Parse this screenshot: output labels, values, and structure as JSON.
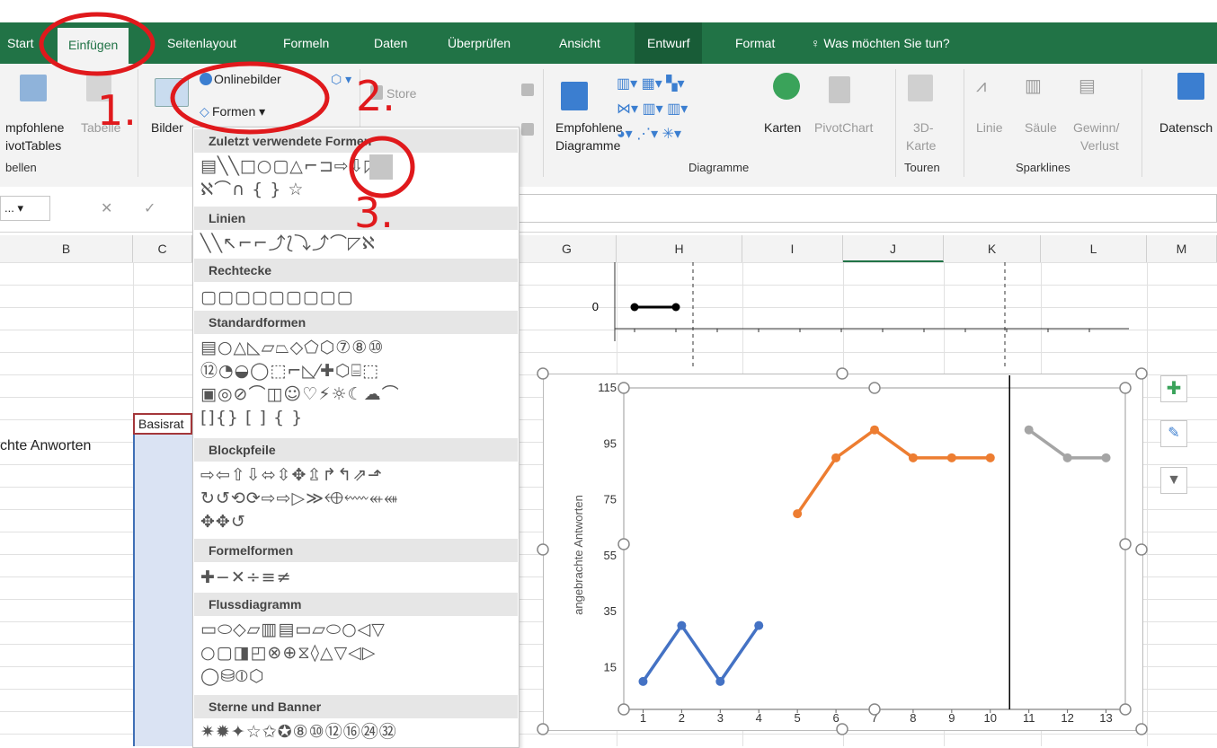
{
  "tabs": {
    "start": "Start",
    "einfuegen": "Einfügen",
    "seitenlayout": "Seitenlayout",
    "formeln": "Formeln",
    "daten": "Daten",
    "ueberpruefen": "Überprüfen",
    "ansicht": "Ansicht",
    "entwurf": "Entwurf",
    "format": "Format",
    "tellme": "Was möchten Sie tun?"
  },
  "ribbon": {
    "pivot_line1": "mpfohlene",
    "pivot_line2": "ivotTables",
    "tabelle": "Tabelle",
    "group_tabellen": "bellen",
    "bilder": "Bilder",
    "onlinebilder": "Onlinebilder",
    "formen": "Formen",
    "store": "Store",
    "empf_diag_line1": "Empfohlene",
    "empf_diag_line2": "Diagramme",
    "karten": "Karten",
    "pivotchart": "PivotChart",
    "karte3d_line1": "3D-",
    "karte3d_line2": "Karte",
    "linie": "Linie",
    "saeule": "Säule",
    "gewinn_line1": "Gewinn/",
    "gewinn_line2": "Verlust",
    "datensch": "Datensch",
    "group_diagramme": "Diagramme",
    "group_touren": "Touren",
    "group_sparklines": "Sparklines"
  },
  "namebox": "...",
  "columns": [
    "B",
    "C",
    "G",
    "H",
    "I",
    "J",
    "K",
    "L",
    "M"
  ],
  "cells": {
    "basisrat": "Basisrat",
    "anworten": "chte Anworten"
  },
  "menu": {
    "sec_zuletzt": "Zuletzt verwendete Formen",
    "zuletzt_row1": "▤╲╲□○▢△⌐⊐⇨⇩◸",
    "zuletzt_row2": "ℵ⌒∩ { } ☆",
    "sec_linien": "Linien",
    "linien_row": "╲╲↖⌐⌐⤴⟅⤵⤴⌒◸ℵ",
    "sec_rechtecke": "Rechtecke",
    "rechtecke_row": "▢▢▢▢▢▢▢▢▢",
    "sec_standard": "Standardformen",
    "standard_row1": "▤○△◺▱⏢◇⬠⬡⑦⑧⑩",
    "standard_row2": "⑫◔◒◯⬚⌐◺⁄✚⬡⌸⬚",
    "standard_row3": "▣◎⊘⌒◫☺♡⚡☼☾☁⌒",
    "standard_row4": "[]{} [ ] { }",
    "sec_blockpfeile": "Blockpfeile",
    "block_row1": "⇨⇦⇧⇩⬄⇳✥⇫↱↰⇗⬏",
    "block_row2": "↻↺⟲⟳⇨⇨▷≫⬲⬳⬴⬵",
    "block_row3": "✥✥↺",
    "sec_formel": "Formelformen",
    "formel_row": "✚−✕÷≡≠",
    "sec_fluss": "Flussdiagramm",
    "fluss_row1": "▭⬭◇▱▥▤▭▱⬭○◁▽",
    "fluss_row2": "○▢◨◰⊗⊕⧖◊△▽◁▷",
    "fluss_row3": "◯⛁⦶⬡",
    "sec_sterne": "Sterne und Banner",
    "sterne_row": "✷✹✦☆✩✪⑧⑩⑫⑯㉔㉜"
  },
  "annotations": {
    "a1": "1.",
    "a2": "2.",
    "a3": "3."
  },
  "chart_data": [
    {
      "type": "line",
      "y_ticks": [
        "0"
      ],
      "series": [
        {
          "x": [
            1,
            2
          ],
          "y": [
            0,
            0
          ],
          "color": "#000000"
        }
      ]
    },
    {
      "type": "line",
      "ylabel": "angebrachte Antworten",
      "y_ticks": [
        15,
        35,
        55,
        75,
        95,
        115
      ],
      "x_ticks": [
        1,
        2,
        3,
        4,
        5,
        6,
        7,
        8,
        9,
        10,
        11,
        12,
        13
      ],
      "ylim": [
        0,
        115
      ],
      "xlim": [
        0.5,
        13.5
      ],
      "phase_line_x": 10.5,
      "series": [
        {
          "x": [
            1,
            2,
            3,
            4
          ],
          "y": [
            10,
            30,
            10,
            30
          ],
          "color": "#4472c4"
        },
        {
          "x": [
            5,
            6,
            7,
            8,
            9,
            10
          ],
          "y": [
            70,
            90,
            100,
            90,
            90,
            90
          ],
          "color": "#ed7d31"
        },
        {
          "x": [
            11,
            12,
            13
          ],
          "y": [
            100,
            90,
            90
          ],
          "color": "#a5a5a5"
        }
      ]
    }
  ],
  "colors": {
    "excel_green": "#217346",
    "annotation_red": "#e0191c",
    "selection_blue": "#dae3f3"
  }
}
